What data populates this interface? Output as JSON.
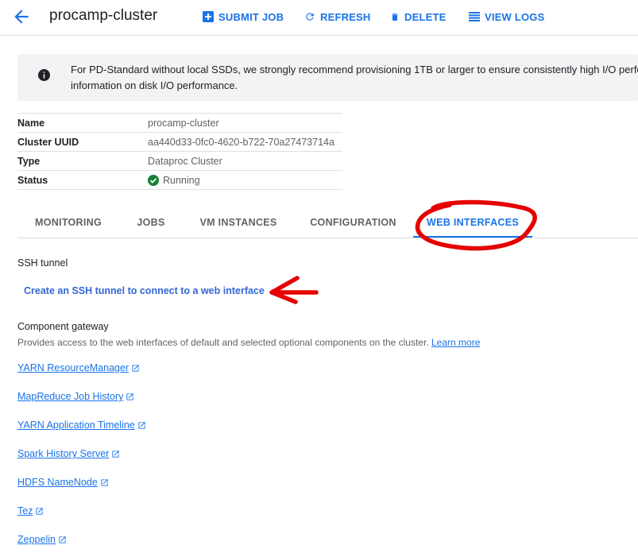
{
  "header": {
    "title": "procamp-cluster",
    "actions": {
      "submit_job": "SUBMIT JOB",
      "refresh": "REFRESH",
      "delete": "DELETE",
      "view_logs": "VIEW LOGS"
    }
  },
  "banner": {
    "text_line1": "For PD-Standard without local SSDs, we strongly recommend provisioning 1TB or larger to ensure consistently high I/O perfo",
    "text_line2": "information on disk I/O performance."
  },
  "details": {
    "rows": [
      {
        "key": "Name",
        "value": "procamp-cluster"
      },
      {
        "key": "Cluster UUID",
        "value": "aa440d33-0fc0-4620-b722-70a27473714a"
      },
      {
        "key": "Type",
        "value": "Dataproc Cluster"
      },
      {
        "key": "Status",
        "value": "Running"
      }
    ]
  },
  "tabs": [
    "MONITORING",
    "JOBS",
    "VM INSTANCES",
    "CONFIGURATION",
    "WEB INTERFACES"
  ],
  "active_tab": "WEB INTERFACES",
  "ssh": {
    "label": "SSH tunnel",
    "link": "Create an SSH tunnel to connect to a web interface"
  },
  "gateway": {
    "label": "Component gateway",
    "description": "Provides access to the web interfaces of default and selected optional components on the cluster.",
    "learn_more": "Learn more",
    "links": [
      "YARN ResourceManager",
      "MapReduce Job History",
      "YARN Application Timeline",
      "Spark History Server",
      "HDFS NameNode",
      "Tez",
      "Zeppelin"
    ]
  },
  "colors": {
    "accent": "#1a73e8",
    "status_ok": "#188038",
    "annotation": "#e60000"
  }
}
